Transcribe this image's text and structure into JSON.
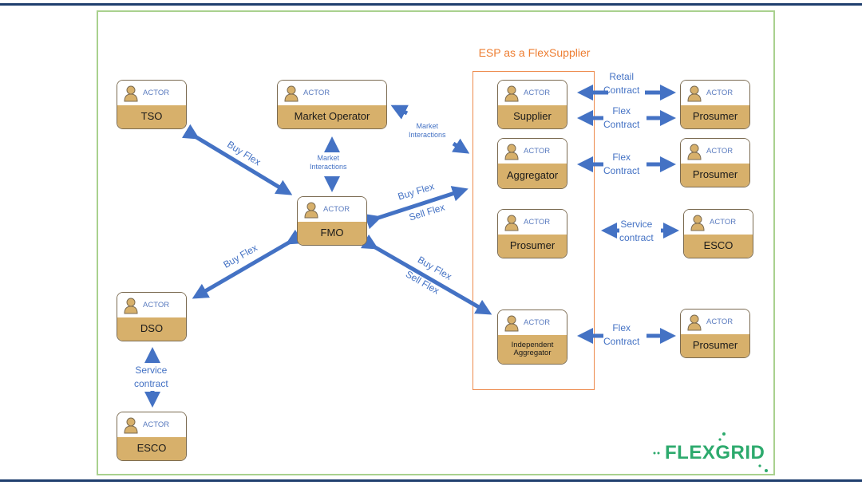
{
  "diagram": {
    "group_title": "ESP as a FlexSupplier",
    "actor_tag": "ACTOR",
    "actors": {
      "tso": "TSO",
      "market_operator": "Market Operator",
      "fmo": "FMO",
      "dso": "DSO",
      "esco_left": "ESCO",
      "supplier": "Supplier",
      "aggregator": "Aggregator",
      "prosumer_inner": "Prosumer",
      "independent_aggregator": "Independent Aggregator",
      "prosumer_1": "Prosumer",
      "prosumer_2": "Prosumer",
      "esco_right": "ESCO",
      "prosumer_3": "Prosumer"
    },
    "labels": {
      "tso_fmo": "Buy Flex",
      "mo_fmo_1": "Market",
      "mo_fmo_2": "Interactions",
      "mo_esp_1": "Market",
      "mo_esp_2": "Interactions",
      "fmo_esp_buy": "Buy Flex",
      "fmo_esp_sell": "Sell Flex",
      "fmo_dso": "Buy Flex",
      "fmo_ia_buy": "Buy Flex",
      "fmo_ia_sell": "Sell Flex",
      "dso_esco_1": "Service",
      "dso_esco_2": "contract",
      "retail_1": "Retail",
      "retail_2": "Contract",
      "flex1_1": "Flex",
      "flex1_2": "Contract",
      "flex2_1": "Flex",
      "flex2_2": "Contract",
      "service_1": "Service",
      "service_2": "contract",
      "flex3_1": "Flex",
      "flex3_2": "Contract"
    },
    "logo": "FLEXGRID",
    "colors": {
      "arrow": "#4472c4",
      "actor_fill": "#d7b06b",
      "group_border": "#ed7d31",
      "frame_border": "#a9d18e",
      "logo": "#2daa6d"
    }
  }
}
